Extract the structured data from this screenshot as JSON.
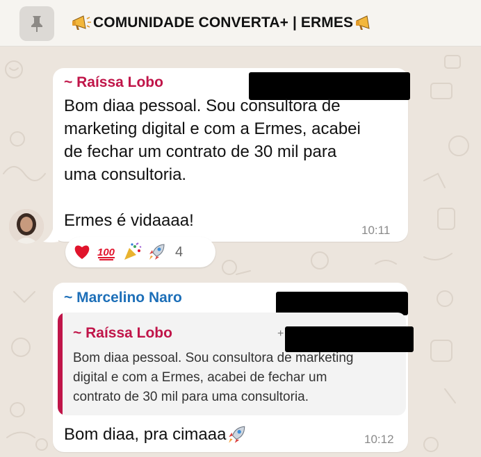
{
  "pinned": {
    "title": "COMUNIDADE CONVERTA+ | ERMES",
    "icon": "pin-icon",
    "leading_emoji": "megaphone",
    "trailing_emoji": "megaphone"
  },
  "messages": [
    {
      "sender": "~ Raíssa Lobo",
      "sender_color": "#c01549",
      "lines": [
        "Bom diaa pessoal. Sou consultora de",
        "marketing digital e com a Ermes, acabei",
        "de fechar um contrato de 30 mil para",
        "uma consultoria.",
        "",
        "Ermes é vidaaaa!"
      ],
      "time": "10:11",
      "reactions": {
        "emojis": [
          "red-heart",
          "hundred-points",
          "party-popper",
          "rocket"
        ],
        "count": "4"
      }
    },
    {
      "sender": "~ Marcelino Naro",
      "sender_color": "#1d6fb8",
      "quote": {
        "sender": "~ Raíssa Lobo",
        "plus": "+",
        "lines": [
          "Bom diaa pessoal. Sou consultora de marketing",
          "digital e com a Ermes, acabei de fechar um",
          "contrato de 30 mil para uma consultoria."
        ]
      },
      "text": "Bom diaa, pra cimaaa",
      "text_emoji": "rocket",
      "time": "10:12"
    }
  ]
}
